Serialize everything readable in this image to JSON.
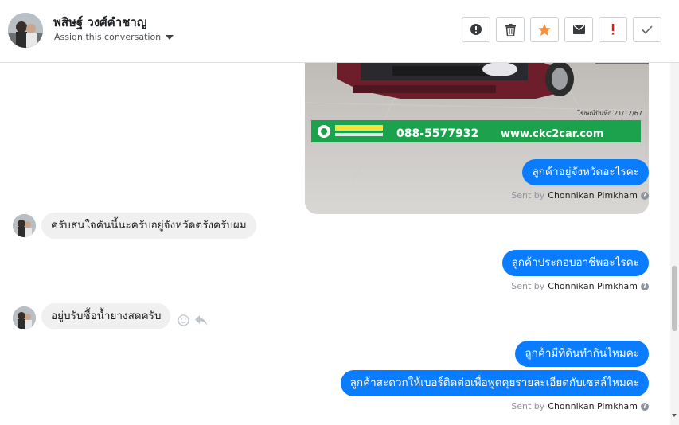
{
  "header": {
    "contact_name": "พสิษฐ์ วงศ์คำชาญ",
    "assign_label": "Assign this conversation",
    "buttons": [
      {
        "icon": "exclamation-circle-icon"
      },
      {
        "icon": "trash-icon"
      },
      {
        "icon": "star-icon",
        "color": "#f7923b"
      },
      {
        "icon": "envelope-icon"
      },
      {
        "icon": "exclamation-icon",
        "color": "#e02020"
      },
      {
        "icon": "check-icon"
      }
    ]
  },
  "photo": {
    "banner_phone": "088-5577932",
    "banner_site": "www.ckc2car.com",
    "date_stamp": "โฆษณ์ปันทึก 21/12/67",
    "banner_color": "#1ca24d"
  },
  "messages": [
    {
      "side": "out",
      "text": "ลูกค้าอยู่จังหวัดอะไรคะ"
    },
    {
      "side": "in",
      "text": "ครับสนใจคันนี้นะครับอยู่จังหวัดตรังครับผม"
    },
    {
      "side": "out",
      "text": "ลูกค้าประกอบอาชีพอะไรคะ"
    },
    {
      "side": "in",
      "text": "อยู่บรับซื้อน้ำยางสดครับ"
    },
    {
      "side": "out",
      "text": "ลูกค้ามีที่ดินทำกินไหมคะ"
    },
    {
      "side": "out",
      "text": "ลูกค้าสะดวกให้เบอร์ติดต่อเพื่อพูดคุยรายละเอียดกับเซลล์ไหมคะ"
    }
  ],
  "sent_by": {
    "prefix": "Sent by",
    "name": "Chonnikan Pimkham"
  },
  "colors": {
    "outgoing_bubble": "#0a7cff",
    "incoming_bubble": "#f1f0f0"
  }
}
